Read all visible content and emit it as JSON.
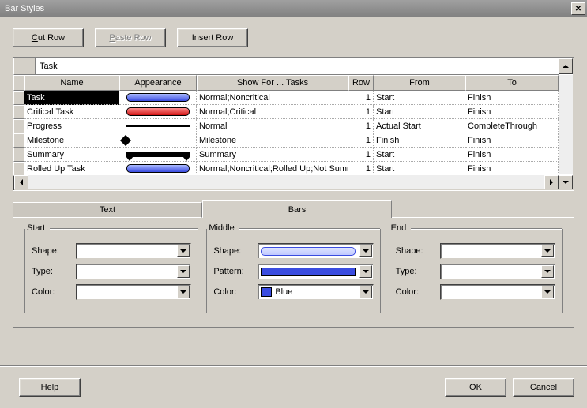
{
  "window": {
    "title": "Bar Styles"
  },
  "buttons": {
    "cut": "Cut Row",
    "paste": "Paste Row",
    "insert": "Insert Row",
    "help": "Help",
    "ok": "OK",
    "cancel": "Cancel"
  },
  "grid": {
    "current_input": "Task",
    "headers": {
      "name": "Name",
      "appearance": "Appearance",
      "show": "Show For ... Tasks",
      "row": "Row",
      "from": "From",
      "to": "To"
    },
    "rows": [
      {
        "name": "Task",
        "appearance": "blue",
        "show": "Normal;Noncritical",
        "row": "1",
        "from": "Start",
        "to": "Finish",
        "selected": true
      },
      {
        "name": "Critical Task",
        "appearance": "red",
        "show": "Normal;Critical",
        "row": "1",
        "from": "Start",
        "to": "Finish"
      },
      {
        "name": "Progress",
        "appearance": "black-thin",
        "show": "Normal",
        "row": "1",
        "from": "Actual Start",
        "to": "CompleteThrough"
      },
      {
        "name": "Milestone",
        "appearance": "diamond",
        "show": "Milestone",
        "row": "1",
        "from": "Finish",
        "to": "Finish"
      },
      {
        "name": "Summary",
        "appearance": "summary",
        "show": "Summary",
        "row": "1",
        "from": "Start",
        "to": "Finish"
      },
      {
        "name": "Rolled Up Task",
        "appearance": "blue",
        "show": "Normal;Noncritical;Rolled Up;Not Summary",
        "row": "1",
        "from": "Start",
        "to": "Finish"
      }
    ]
  },
  "tabs": {
    "text": "Text",
    "bars": "Bars",
    "active": "bars"
  },
  "fieldsets": {
    "start": {
      "legend": "Start",
      "shape_label": "Shape:",
      "type_label": "Type:",
      "color_label": "Color:",
      "shape": "",
      "type": "",
      "color": ""
    },
    "middle": {
      "legend": "Middle",
      "shape_label": "Shape:",
      "pattern_label": "Pattern:",
      "color_label": "Color:",
      "shape": "",
      "pattern": "",
      "color": "Blue",
      "color_hex": "#3a4ce0"
    },
    "end": {
      "legend": "End",
      "shape_label": "Shape:",
      "type_label": "Type:",
      "color_label": "Color:",
      "shape": "",
      "type": "",
      "color": ""
    }
  }
}
